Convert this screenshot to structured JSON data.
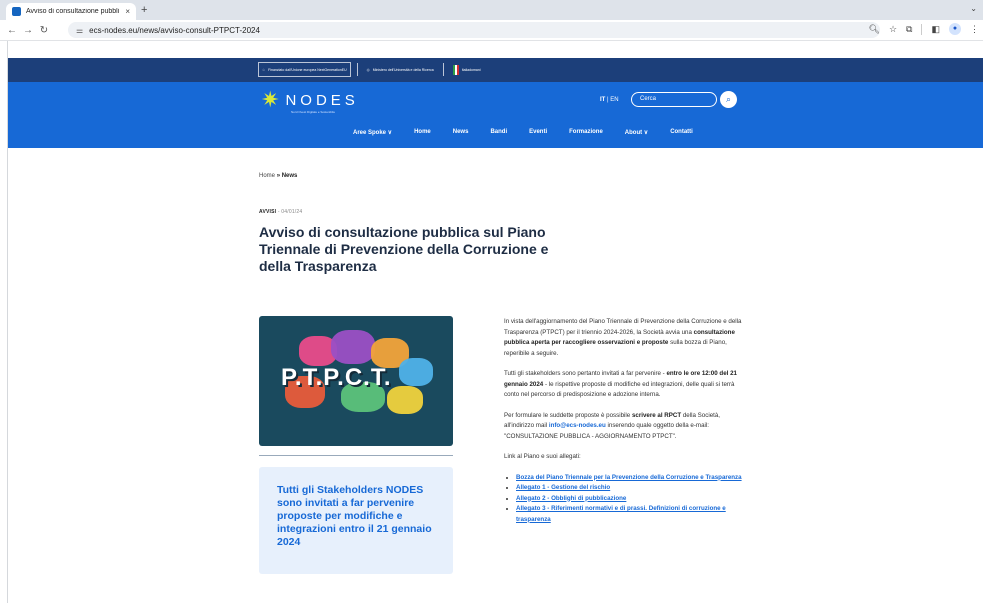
{
  "browser": {
    "tab_title": "Avviso di consultazione pubbli",
    "tab_close": "×",
    "new_tab": "+",
    "url": "ecs-nodes.eu/news/avviso-consult-PTPCT-2024"
  },
  "site": {
    "logos": {
      "eu": "Finanziato dall'Unione europea NextGenerationEU",
      "mur": "Ministero dell'Università e della Ricerca",
      "italiadomani": "Italiadomani"
    },
    "brand_name": "NODES",
    "brand_sub": "Nord Ovest Digitale e Sostenibile",
    "lang_it": "IT",
    "lang_sep": "|",
    "lang_en": "EN",
    "search_placeholder": "Cerca",
    "menu": [
      "Aree Spoke ∨",
      "Home",
      "News",
      "Bandi",
      "Eventi",
      "Formazione",
      "About ∨",
      "Contatti"
    ]
  },
  "article": {
    "breadcrumb_home": "Home",
    "breadcrumb_sep": "»",
    "breadcrumb_current": "News",
    "category": "AVVISI",
    "date": "- 04/01/24",
    "title": "Avviso di consultazione pubblica sul Piano Triennale di Prevenzione della Corruzione e della Trasparenza",
    "image_text": "P.T.P.C.T.",
    "callout": "Tutti gli Stakeholders NODES sono invitati a far pervenire proposte per modifiche e integrazioni entro il 21 gennaio 2024",
    "p1_a": "In vista dell'aggiornamento del Piano Triennale di Prevenzione della Corruzione e della Trasparenza (PTPCT) per il triennio 2024-2026, la Società avvia una ",
    "p1_b": "consultazione pubblica aperta per raccogliere osservazioni e proposte",
    "p1_c": " sulla bozza di Piano, reperibile a seguire.",
    "p2_a": "Tutti gli stakeholders sono pertanto invitati a far pervenire - ",
    "p2_b": "entro le ore 12:00 del 21 gennaio 2024",
    "p2_c": " - le rispettive proposte di modifiche ed integrazioni, delle quali si terrà conto nel percorso di predisposizione e adozione interna.",
    "p3_a": "Per formulare le suddette proposte è possibile ",
    "p3_b": "scrivere al RPCT",
    "p3_c": " della Società, all'indirizzo mail ",
    "p3_mail": "info@ecs-nodes.eu",
    "p3_d": " inserendo quale oggetto della e-mail: \"CONSULTAZIONE PUBBLICA - AGGIORNAMENTO PTPCT\".",
    "p4": "Link al Piano e suoi allegati:",
    "links": [
      "Bozza del Piano Triennale per la Prevenzione della Corruzione e Trasparenza",
      "Allegato 1 - Gestione del rischio",
      "Allegato 2 - Obblighi di pubblicazione",
      "Allegato 3 - Riferimenti normativi e di prassi. Definizioni di corruzione e trasparenza"
    ]
  },
  "colors": {
    "primary": "#1769d6",
    "dark_band": "#1c3f7a",
    "brand_accent": "#d8e83a"
  }
}
